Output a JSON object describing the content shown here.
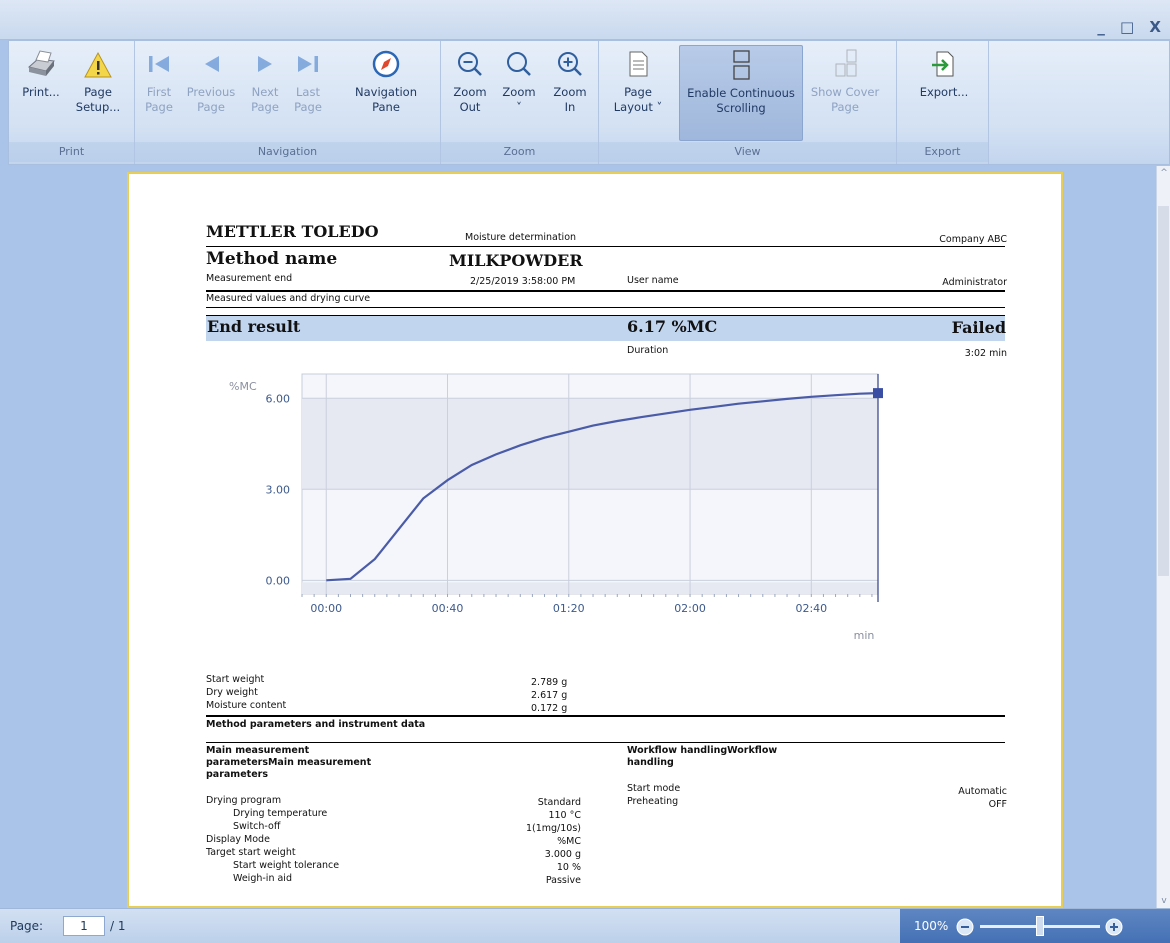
{
  "window": {
    "controls": "_ □ X"
  },
  "ribbon": {
    "groups": [
      {
        "label": "Print"
      },
      {
        "label": "Navigation"
      },
      {
        "label": "Zoom"
      },
      {
        "label": "View"
      },
      {
        "label": "Export"
      }
    ],
    "buttons": {
      "print": {
        "label": "Print...",
        "icon": "printer-icon"
      },
      "page_setup": {
        "label": "Page\nSetup...",
        "icon": "page-setup-warning-icon"
      },
      "first_page": {
        "label": "First\nPage",
        "icon": "first-page-icon"
      },
      "previous_page": {
        "label": "Previous\nPage",
        "icon": "previous-page-icon"
      },
      "next_page": {
        "label": "Next\nPage",
        "icon": "next-page-icon"
      },
      "last_page": {
        "label": "Last\nPage",
        "icon": "last-page-icon"
      },
      "navigation_pane": {
        "label": "Navigation\nPane",
        "icon": "compass-icon"
      },
      "zoom_out": {
        "label": "Zoom\nOut",
        "icon": "zoom-out-icon"
      },
      "zoom": {
        "label": "Zoom\n˅",
        "icon": "zoom-icon"
      },
      "zoom_in": {
        "label": "Zoom\nIn",
        "icon": "zoom-in-icon"
      },
      "page_layout": {
        "label": "Page\nLayout ˅",
        "icon": "page-layout-icon"
      },
      "continuous_scrolling": {
        "label": "Enable Continuous\nScrolling",
        "icon": "continuous-scrolling-icon"
      },
      "show_cover_page": {
        "label": "Show Cover\nPage",
        "icon": "cover-page-icon"
      },
      "export": {
        "label": "Export...",
        "icon": "export-icon"
      }
    }
  },
  "report": {
    "brand": "METTLER TOLEDO",
    "report_type": "Moisture determination",
    "company": "Company ABC",
    "method_label": "Method name",
    "method_value": "MILKPOWDER",
    "measurement_end_label": "Measurement end",
    "measurement_end_value": "2/25/2019 3:58:00 PM",
    "user_label": "User name",
    "user_value": "Administrator",
    "section_measured": "Measured values and drying curve",
    "end_result_label": "End result",
    "end_result_value": "6.17 %MC",
    "end_result_status": "Failed",
    "duration_label": "Duration",
    "duration_value": "3:02 min",
    "start_weight_label": "Start weight",
    "start_weight_value": "2.789 g",
    "dry_weight_label": "Dry weight",
    "dry_weight_value": "2.617 g",
    "moisture_label": "Moisture content",
    "moisture_value": "0.172 g",
    "section_params": "Method parameters and instrument data",
    "main_params_title": "Main measurement\nparametersMain measurement\nparameters",
    "workflow_title": "Workflow handlingWorkflow\nhandling",
    "params_left": [
      {
        "label": "Drying program",
        "value": "Standard",
        "indent": false
      },
      {
        "label": "Drying temperature",
        "value": "110 °C",
        "indent": true
      },
      {
        "label": "Switch-off",
        "value": "1(1mg/10s)",
        "indent": true
      },
      {
        "label": "Display Mode",
        "value": "%MC",
        "indent": false
      },
      {
        "label": "Target start weight",
        "value": "3.000 g",
        "indent": false
      },
      {
        "label": "Start weight tolerance",
        "value": "10 %",
        "indent": true
      },
      {
        "label": "Weigh-in aid",
        "value": "Passive",
        "indent": true
      }
    ],
    "params_right": [
      {
        "label": "Start mode",
        "value": "Automatic"
      },
      {
        "label": "Preheating",
        "value": "OFF"
      }
    ]
  },
  "chart_data": {
    "type": "line",
    "ylabel": "%MC",
    "xlabel": "min",
    "x_tick_labels": [
      "00:00",
      "00:40",
      "01:20",
      "02:00",
      "02:40"
    ],
    "x_ticks_seconds": [
      0,
      40,
      80,
      120,
      160
    ],
    "y_tick_labels": [
      "0.00",
      "3.00",
      "6.00"
    ],
    "y_ticks": [
      0,
      3,
      6
    ],
    "xlim_seconds": [
      -8,
      182
    ],
    "ylim": [
      -0.45,
      6.8
    ],
    "grid": true,
    "end_marker": {
      "x_seconds": 182,
      "y": 6.17
    },
    "series": [
      {
        "x_seconds": [
          0,
          8,
          16,
          24,
          32,
          40,
          48,
          56,
          64,
          72,
          80,
          88,
          96,
          104,
          112,
          120,
          128,
          136,
          144,
          152,
          160,
          168,
          176,
          182
        ],
        "values": [
          0.0,
          0.05,
          0.7,
          1.7,
          2.7,
          3.3,
          3.8,
          4.15,
          4.45,
          4.7,
          4.9,
          5.1,
          5.25,
          5.38,
          5.5,
          5.62,
          5.72,
          5.82,
          5.9,
          5.98,
          6.05,
          6.1,
          6.15,
          6.17
        ],
        "color": "#4a5ba8"
      }
    ]
  },
  "status": {
    "page_label": "Page:",
    "page_current": "1",
    "page_total": "/ 1",
    "zoom": "100%"
  }
}
